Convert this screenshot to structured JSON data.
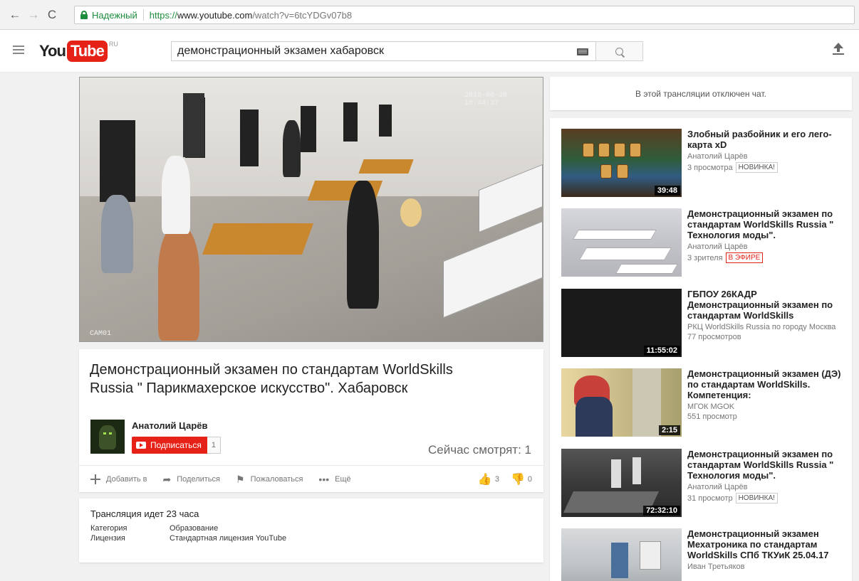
{
  "browser": {
    "secure_label": "Надежный",
    "url_scheme": "https://",
    "url_host": "www.youtube.com",
    "url_path": "/watch?v=6tcYDGv07b8"
  },
  "masthead": {
    "logo_you": "You",
    "logo_tube": "Tube",
    "logo_region": "RU",
    "search_value": "демонстрационный экзамен хабаровск"
  },
  "player": {
    "camera_label": "CAM01",
    "camera_timestamp": "2018-06-20 10:44:37"
  },
  "video": {
    "title": "Демонстрационный экзамен по стандартам WorldSkills Russia \" Парикмахерское искусство\". Хабаровск",
    "channel": "Анатолий Царёв",
    "subscribe_label": "Подписаться",
    "subscriber_count": "1",
    "live_viewers": "Сейчас смотрят: 1",
    "actions": {
      "add_to": "Добавить в",
      "share": "Поделиться",
      "report": "Пожаловаться",
      "more": "Ещё"
    },
    "likes": "3",
    "dislikes": "0"
  },
  "description": {
    "live_status": "Трансляция идет 23 часа",
    "category_label": "Категория",
    "category_value": "Образование",
    "license_label": "Лицензия",
    "license_value": "Стандартная лицензия YouTube"
  },
  "chat": {
    "disabled_text": "В этой трансляции отключен чат."
  },
  "related": [
    {
      "title": "Злобный разбойник и его лего-карта xD",
      "channel": "Анатолий Царёв",
      "views": "3 просмотра",
      "badge": "НОВИНКА!",
      "duration": "39:48"
    },
    {
      "title": "Демонстрационный экзамен по стандартам WorldSkills Russia \" Технология моды\".",
      "channel": "Анатолий Царёв",
      "views": "3 зрителя",
      "badge": "В ЭФИРЕ",
      "duration": ""
    },
    {
      "title": "ГБПОУ 26КАДР Демонстрационный экзамен по стандартам WorldSkills",
      "channel": "РКЦ WorldSkills Russia по городу Москва",
      "views": "77 просмотров",
      "badge": "",
      "duration": "11:55:02"
    },
    {
      "title": "Демонстрационный экзамен (ДЭ) по стандартам WorldSkills. Компетенция:",
      "channel": "МГОК MGOK",
      "views": "551 просмотр",
      "badge": "",
      "duration": "2:15"
    },
    {
      "title": "Демонстрационный экзамен по стандартам WorldSkills Russia \" Технология моды\".",
      "channel": "Анатолий Царёв",
      "views": "31 просмотр",
      "badge": "НОВИНКА!",
      "duration": "72:32:10"
    },
    {
      "title": "Демонстрационный экзамен Мехатроника по стандартам WorldSkills СПб ТКУиК 25.04.17",
      "channel": "Иван Третьяков",
      "views": "",
      "badge": "",
      "duration": ""
    }
  ]
}
